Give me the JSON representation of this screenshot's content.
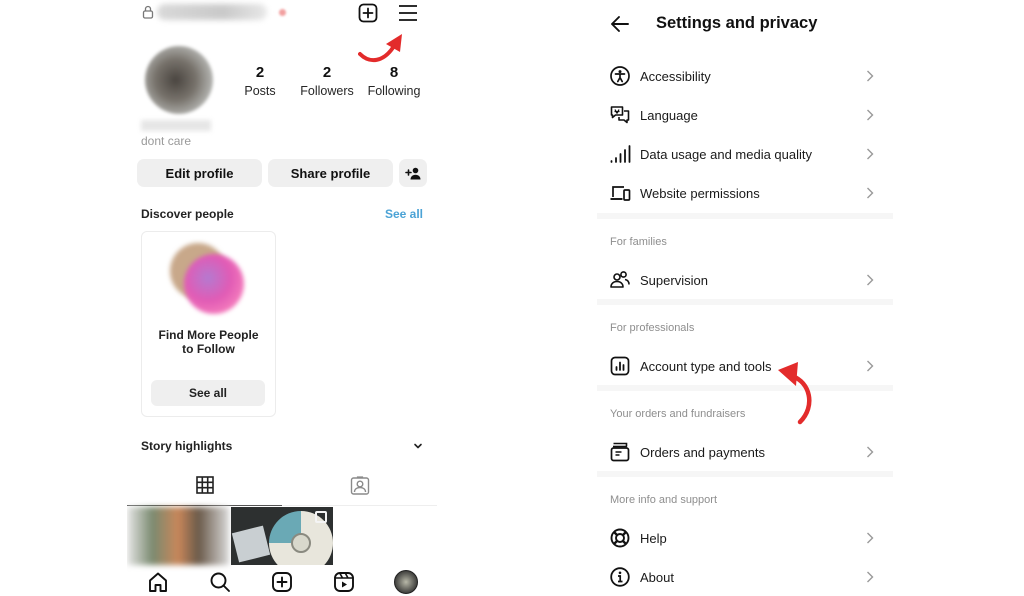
{
  "profile": {
    "username": "",
    "stats": [
      {
        "value": "2",
        "label": "Posts"
      },
      {
        "value": "2",
        "label": "Followers"
      },
      {
        "value": "8",
        "label": "Following"
      }
    ],
    "bio": "dont care",
    "buttons": {
      "edit": "Edit profile",
      "share": "Share profile"
    },
    "discover": {
      "title": "Discover people",
      "see_all": "See all",
      "card": {
        "title": "Find More People to Follow",
        "button": "See all"
      }
    },
    "highlights": {
      "title": "Story highlights"
    },
    "tabs": [
      {
        "name": "posts-grid",
        "icon": "grid-icon",
        "active": true
      },
      {
        "name": "tagged",
        "icon": "tagged-person-icon",
        "active": false
      }
    ],
    "bottom_nav": [
      {
        "icon": "home-icon"
      },
      {
        "icon": "search-icon"
      },
      {
        "icon": "create-icon"
      },
      {
        "icon": "reels-icon"
      },
      {
        "icon": "profile-avatar"
      }
    ]
  },
  "settings": {
    "title": "Settings and privacy",
    "groups": [
      {
        "header": "",
        "items": [
          {
            "icon": "accessibility-icon",
            "label": "Accessibility"
          },
          {
            "icon": "language-icon",
            "label": "Language"
          },
          {
            "icon": "signal-bars-icon",
            "label": "Data usage and media quality"
          },
          {
            "icon": "devices-icon",
            "label": "Website permissions"
          }
        ]
      },
      {
        "header": "For families",
        "items": [
          {
            "icon": "supervision-icon",
            "label": "Supervision"
          }
        ]
      },
      {
        "header": "For professionals",
        "items": [
          {
            "icon": "chart-box-icon",
            "label": "Account type and tools"
          }
        ]
      },
      {
        "header": "Your orders and fundraisers",
        "items": [
          {
            "icon": "orders-icon",
            "label": "Orders and payments"
          }
        ]
      },
      {
        "header": "More info and support",
        "items": [
          {
            "icon": "help-lifebuoy-icon",
            "label": "Help"
          },
          {
            "icon": "info-icon",
            "label": "About"
          }
        ]
      }
    ]
  },
  "annotations": {
    "arrow_color": "#e32b2b"
  },
  "colors": {
    "link_blue": "#4ba3d6",
    "button_gray": "#efefef",
    "section_header": "#8e8e8e"
  }
}
